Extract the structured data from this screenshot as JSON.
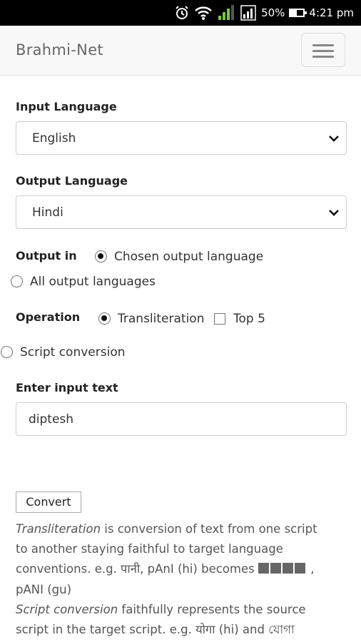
{
  "status_bar": {
    "battery": "50%",
    "battery_level": 0.5,
    "time": "4:21 pm"
  },
  "navbar": {
    "brand": "Brahmi-Net"
  },
  "form": {
    "input_language_label": "Input Language",
    "input_language_value": "English",
    "output_language_label": "Output Language",
    "output_language_value": "Hindi",
    "output_in_label": "Output in",
    "output_in_options": [
      "Chosen output language",
      "All output languages"
    ],
    "operation_label": "Operation",
    "operation_options": [
      "Transliteration",
      "Script conversion"
    ],
    "top5_label": "Top 5",
    "input_text_label": "Enter input text",
    "input_text_value": "diptesh",
    "convert_label": "Convert"
  },
  "description": {
    "translit_term": "Transliteration",
    "translit_line1_rest": " is conversion of text from one script",
    "translit_line2": "to another staying faithful to target language",
    "translit_line3_pre": "conventions. e.g. पानी, pAnI (hi) becomes ",
    "translit_line3_post": " ,",
    "translit_line4": "pANI (gu)",
    "script_term": "Script conversion",
    "script_line1_rest": " faithfully represents the source",
    "script_line2": "script in the target script. e.g. योगा (hi) and যোগা"
  }
}
